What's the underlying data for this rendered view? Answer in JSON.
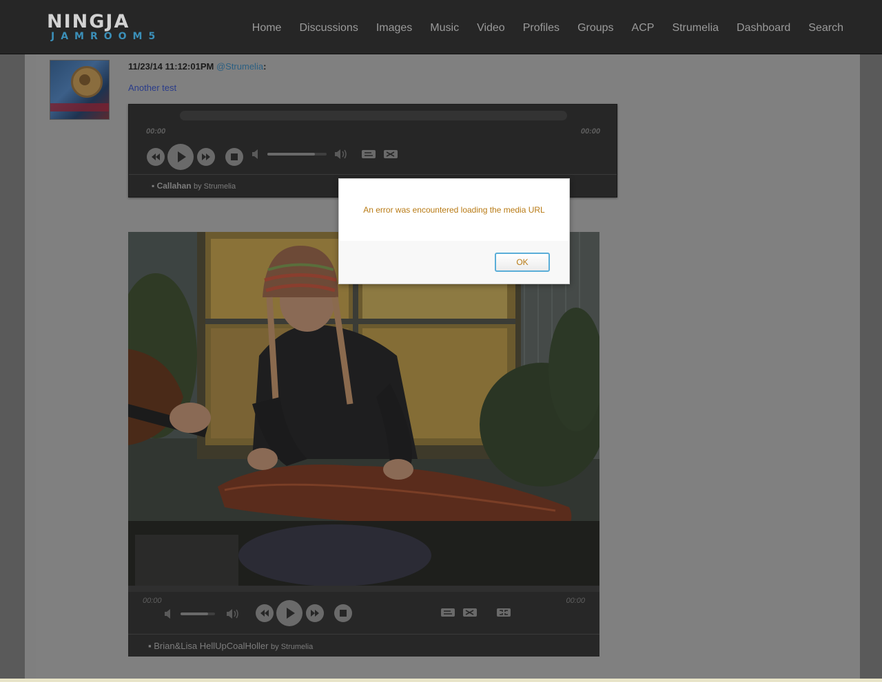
{
  "header": {
    "logo_top": "NINGJA",
    "logo_bottom": "JAMROOM5",
    "nav": [
      "Home",
      "Discussions",
      "Images",
      "Music",
      "Video",
      "Profiles",
      "Groups",
      "ACP",
      "Strumelia",
      "Dashboard",
      "Search"
    ]
  },
  "post": {
    "timestamp": "11/23/14 11:12:01PM",
    "user": "@Strumelia",
    "title": "Another test"
  },
  "audio_player": {
    "time_left": "00:00",
    "time_right": "00:00",
    "track_name": "Callahan",
    "by_label": "by Strumelia",
    "volume_level": 0.8
  },
  "video_player": {
    "time_left": "00:00",
    "time_right": "00:00",
    "track_name": "Brian&Lisa HellUpCoalHoller",
    "by_label": "by Strumelia",
    "volume_level": 0.8
  },
  "dialog": {
    "message": "An error was encountered loading the media URL",
    "ok_label": "OK"
  },
  "icons": {
    "rewind": "rewind-icon",
    "play": "play-icon",
    "forward": "fast-forward-icon",
    "stop": "stop-icon",
    "mute": "volume-mute-icon",
    "vol_max": "volume-max-icon",
    "repeat": "repeat-icon",
    "shuffle": "shuffle-icon",
    "fullscreen": "fullscreen-icon"
  },
  "colors": {
    "header_bg": "#262626",
    "overlay_bg": "#808080",
    "link": "#2b5f82",
    "dialog_text": "#b87a14",
    "button_border": "#5aaed8"
  }
}
